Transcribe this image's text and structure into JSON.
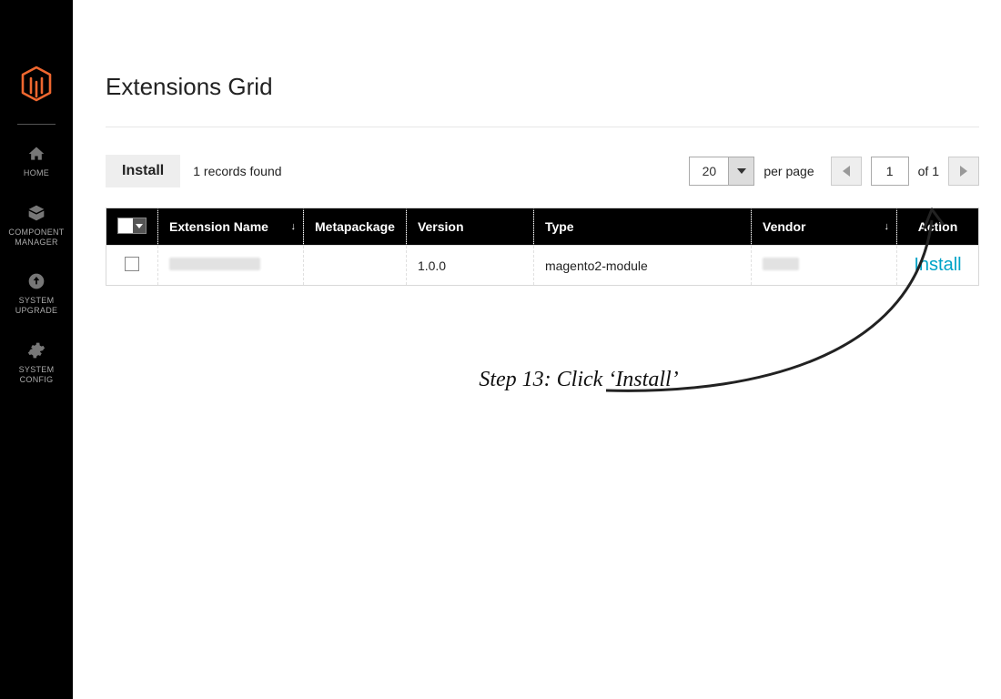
{
  "sidebar": {
    "items": [
      {
        "label": "HOME"
      },
      {
        "label": "COMPONENT\nMANAGER"
      },
      {
        "label": "SYSTEM\nUPGRADE"
      },
      {
        "label": "SYSTEM\nCONFIG"
      }
    ]
  },
  "page": {
    "title": "Extensions Grid"
  },
  "toolbar": {
    "install_label": "Install",
    "records_found": "1 records found",
    "per_page_value": "20",
    "per_page_label": "per page",
    "page_current": "1",
    "page_of": "of 1"
  },
  "grid": {
    "columns": {
      "extension_name": "Extension Name",
      "metapackage": "Metapackage",
      "version": "Version",
      "type": "Type",
      "vendor": "Vendor",
      "action": "Action"
    },
    "rows": [
      {
        "extension_name": "",
        "metapackage": "",
        "version": "1.0.0",
        "type": "magento2-module",
        "vendor": "",
        "action_label": "Install"
      }
    ]
  },
  "annotation": {
    "text": "Step 13: Click ‘Install’"
  }
}
